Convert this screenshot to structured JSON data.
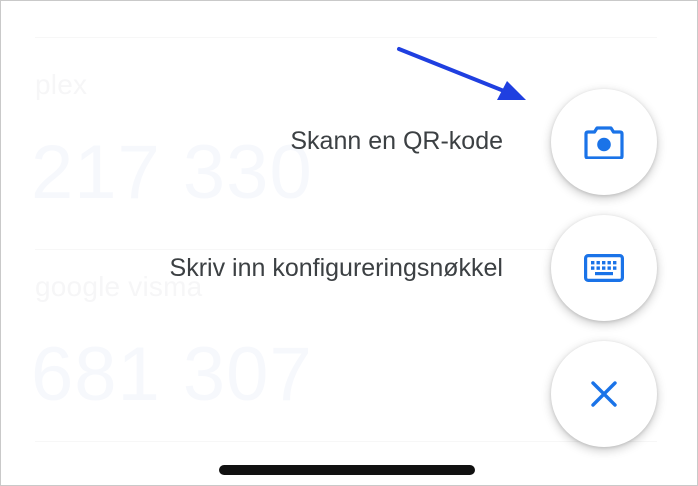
{
  "accounts": [
    {
      "name": "plex",
      "code": "217 330"
    },
    {
      "name": "google visma",
      "code": "681 307"
    }
  ],
  "menu": {
    "scan_label": "Skann en QR-kode",
    "scan_icon": "camera-icon",
    "key_label": "Skriv inn konfigureringsnøkkel",
    "key_icon": "keyboard-icon",
    "close_icon": "close-icon"
  },
  "colors": {
    "accent": "#1a73e8",
    "label": "#3c4043",
    "annotation_arrow": "#1f3fe0"
  }
}
